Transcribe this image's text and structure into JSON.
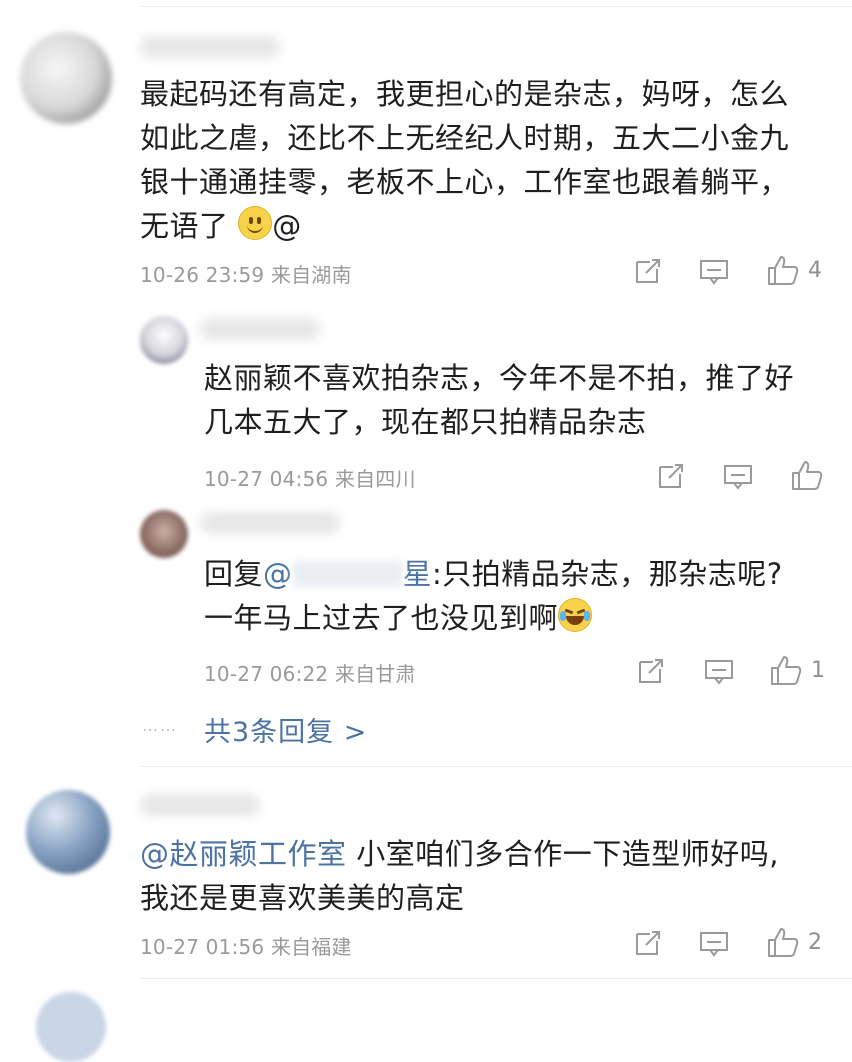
{
  "comments": [
    {
      "text": "最起码还有高定，我更担心的是杂志，妈呀，怎么如此之虐，还比不上无经纪人时期，五大二小金九银十通通挂零，老板不上心，工作室也跟着躺平，无语了",
      "line1": "最起码还有高定，我更担心的是杂志，妈呀，怎么",
      "line2": "如此之虐，还比不上无经纪人时期，五大二小金九",
      "line3": "银十通通挂零，老板不上心，工作室也跟着躺平，",
      "line4": "无语了",
      "trail_at": "@",
      "emoji": "smile-emoji",
      "meta": "10-26 23:59 来自湖南",
      "likes": "4"
    },
    {
      "reply1_line1": "赵丽颖不喜欢拍杂志，今年不是不拍，推了好",
      "reply1_line2": "几本五大了，现在都只拍精品杂志",
      "reply1_meta": "10-27 04:56 来自四川",
      "reply2_prefix": "回复",
      "reply2_mention": "@",
      "reply2_mention_end": "星",
      "reply2_after": ":只拍精品杂志，那杂志呢?",
      "reply2_line2": "一年马上过去了也没见到啊",
      "reply2_emoji": "laugh-cry-emoji",
      "reply2_meta": "10-27 06:22 来自甘肃",
      "reply2_likes": "1",
      "more_dots": "……",
      "more_replies": "共3条回复 >"
    },
    {
      "mention": "@赵丽颖工作室",
      "line1_rest": " 小室咱们多合作一下造型师好吗,",
      "line2": "我还是更喜欢美美的高定",
      "meta": "10-27 01:56 来自福建",
      "likes": "2"
    }
  ],
  "icons": [
    "share-icon",
    "comment-icon",
    "like-icon"
  ],
  "colors": {
    "link": "#4d73a3",
    "meta": "#9a9a9a",
    "divider": "#ececec"
  }
}
